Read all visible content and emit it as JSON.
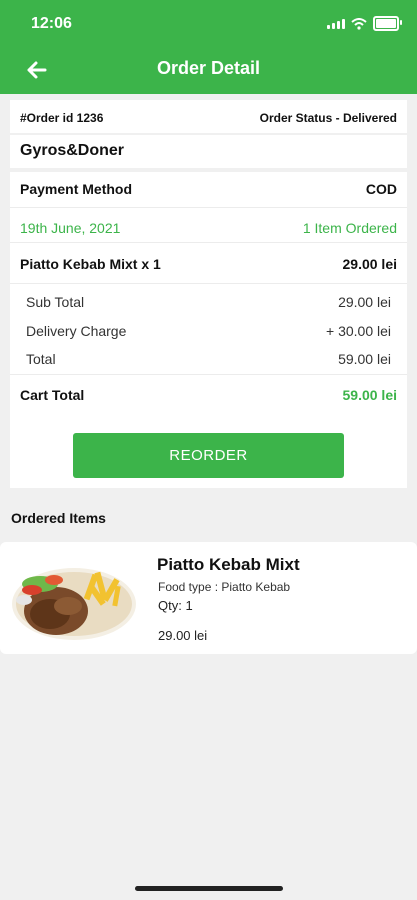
{
  "status_bar": {
    "time": "12:06"
  },
  "header": {
    "title": "Order Detail"
  },
  "order": {
    "id_text": "#Order id 1236",
    "status_text": "Order Status - Delivered",
    "restaurant": "Gyros&Doner",
    "payment_label": "Payment Method",
    "payment_value": "COD",
    "date": "19th June, 2021",
    "items_ordered": "1 Item Ordered",
    "line_item": "Piatto Kebab Mixt  x 1",
    "line_price": "29.00 lei",
    "sub_total_label": "Sub Total",
    "sub_total_value": "29.00 lei",
    "delivery_label": "Delivery Charge",
    "delivery_value": "+ 30.00 lei",
    "total_label": "Total",
    "total_value": "59.00 lei",
    "cart_total_label": "Cart Total",
    "cart_total_value": "59.00 lei",
    "reorder_label": "REORDER"
  },
  "ordered_items": {
    "section_title": "Ordered Items",
    "items": [
      {
        "name": "Piatto Kebab Mixt",
        "food_type": "Food type : Piatto Kebab",
        "qty": "Qty: 1",
        "price": "29.00 lei",
        "image_icon": "kebab-plate-image"
      }
    ]
  },
  "colors": {
    "brand_green": "#3cb44a",
    "background": "#f0f0f0"
  }
}
